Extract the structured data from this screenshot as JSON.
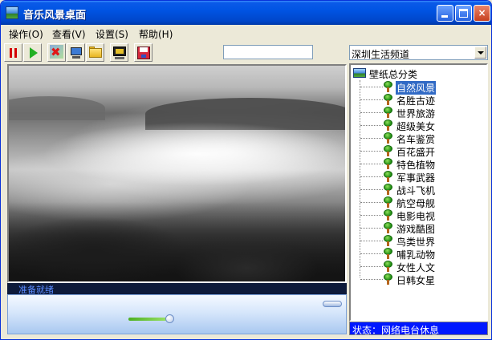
{
  "window": {
    "title": "音乐风景桌面"
  },
  "menu": [
    {
      "label": "操作(O)"
    },
    {
      "label": "查看(V)"
    },
    {
      "label": "设置(S)"
    },
    {
      "label": "帮助(H)"
    }
  ],
  "toolbar": {
    "icons": [
      "pause-icon",
      "play-icon",
      "delete-icon",
      "monitor-icon",
      "folder-icon",
      "screen-icon",
      "disk-icon"
    ],
    "text_value": "",
    "channel_selected": "深圳生活频道"
  },
  "player": {
    "status": "准备就绪",
    "volume_level": 0.55
  },
  "tree": {
    "root": "壁纸总分类",
    "selected": "自然风景",
    "items": [
      "自然风景",
      "名胜古迹",
      "世界旅游",
      "超级美女",
      "名车鉴赏",
      "百花盛开",
      "特色植物",
      "军事武器",
      "战斗飞机",
      "航空母舰",
      "电影电视",
      "游戏酷图",
      "鸟类世界",
      "哺乳动物",
      "女性人文",
      "日韩女星"
    ]
  },
  "statusbar": {
    "text": "状态：网络电台休息"
  },
  "colors": {
    "titlebar": "#0054e3",
    "selection": "#316ac5",
    "statusbar": "#0018ff"
  }
}
